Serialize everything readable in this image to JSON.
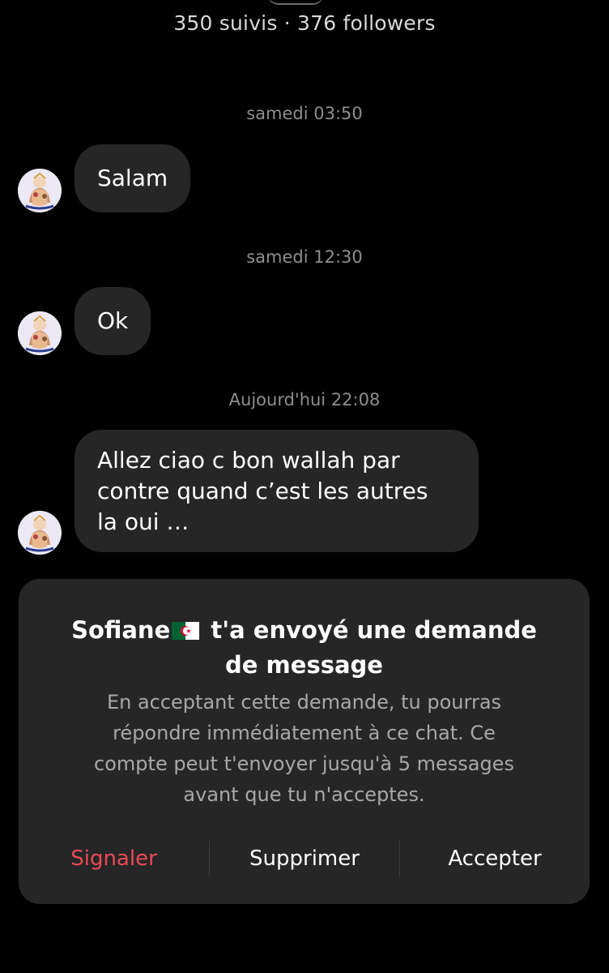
{
  "profile": {
    "stats": "350 suivis · 376 followers"
  },
  "conversation": {
    "messages": [
      {
        "timestamp": "samedi 03:50",
        "text": "Salam"
      },
      {
        "timestamp": "samedi 12:30",
        "text": "Ok"
      },
      {
        "timestamp": "Aujourd'hui 22:08",
        "lines": [
          "Allez ciao c bon wallah par",
          "contre quand c’est les autres",
          "la oui …"
        ]
      }
    ]
  },
  "request": {
    "sender_name": "Sofiane",
    "sender_flag_icon": "algeria-flag-icon",
    "title_rest": "t'a envoyé une demande",
    "title_line2": "de message",
    "body_lines": [
      "En acceptant cette demande, tu pourras",
      "répondre immédiatement à ce chat. Ce",
      "compte peut t'envoyer jusqu'à 5 messages",
      "avant que tu n'acceptes."
    ],
    "actions": {
      "report": "Signaler",
      "delete": "Supprimer",
      "accept": "Accepter"
    }
  },
  "colors": {
    "background": "#000000",
    "bubble": "#262626",
    "card": "#262626",
    "timestamp": "#8e8e8e",
    "danger": "#ed4956"
  }
}
